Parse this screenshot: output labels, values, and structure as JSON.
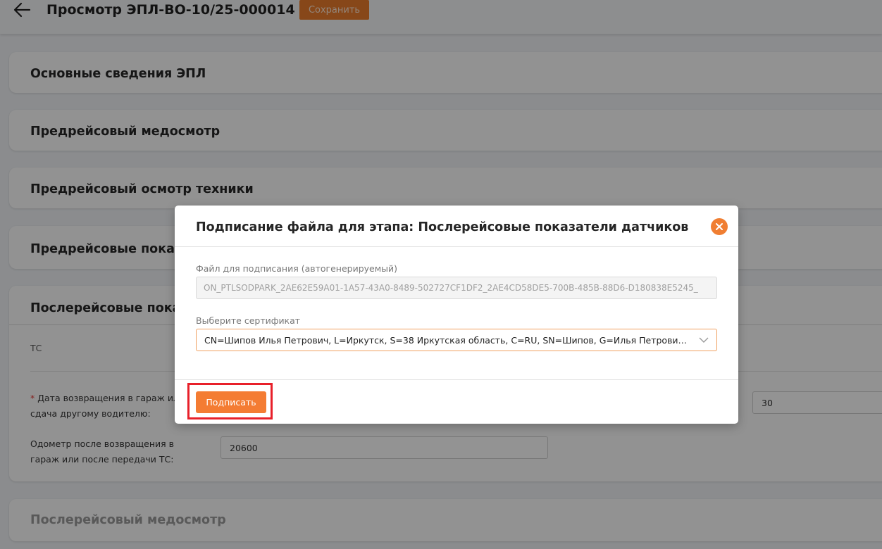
{
  "header": {
    "title": "Просмотр ЭПЛ-ВО-10/25-000014",
    "save_label": "Сохранить"
  },
  "sections": [
    {
      "title": "Основные сведения ЭПЛ"
    },
    {
      "title": "Предрейсовый медосмотр"
    },
    {
      "title": "Предрейсовый осмотр техники"
    },
    {
      "title": "Предрейсовые показатели датчиков"
    },
    {
      "title": "Послерейсовые показатели датчиков"
    },
    {
      "title": "Послерейсовый медосмотр"
    }
  ],
  "section_visible": {
    "s4": "Предрейсовые показа",
    "s5": "Послерейсовые показ"
  },
  "post_trip": {
    "tc_label": "ТС",
    "return_date_label_line1": "Дата возвращения в гараж ил",
    "return_date_label_line2": "сдача другому водителю:",
    "odometer_label_line1": "Одометр после возвращения в",
    "odometer_label_line2": "гараж или после передачи ТС:",
    "odometer_value": "20600",
    "right_value": "30"
  },
  "modal": {
    "title": "Подписание файла для этапа: Послерейсовые показатели датчиков",
    "file_label": "Файл для подписания (автогенерируемый)",
    "file_value": "ON_PTLSODPARK_2AE62E59A01-1A57-43A0-8489-502727CF1DF2_2AE4CD58DE5-700B-485B-88D6-D180838E5245_",
    "cert_label": "Выберите сертификат",
    "cert_value": "CN=Шипов Илья Петрович, L=Иркутск, S=38 Иркутская область, C=RU, SN=Шипов, G=Илья Петрович, И...",
    "sign_label": "Подписать"
  },
  "colors": {
    "accent": "#f47c33",
    "highlight": "#e8202a"
  }
}
